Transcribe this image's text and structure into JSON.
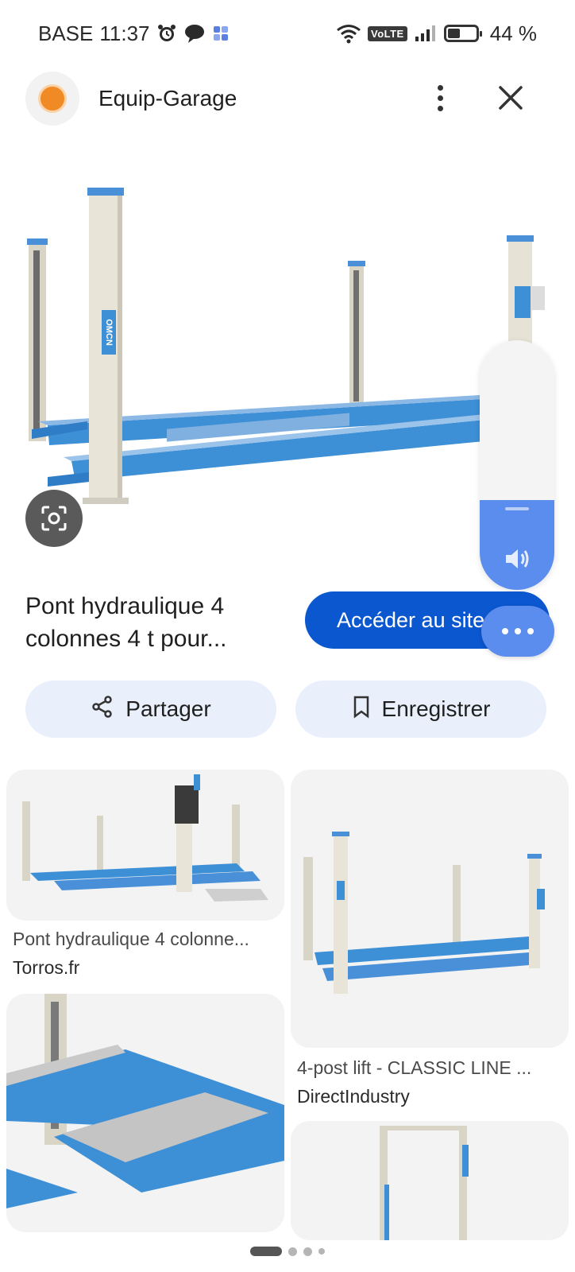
{
  "status_bar": {
    "carrier": "BASE",
    "time": "11:37",
    "network_badge": "VoLTE",
    "battery": "44 %",
    "battery_level": 0.44,
    "icons": [
      "alarm-icon",
      "chat-bubble-icon",
      "app-grid-icon",
      "wifi-icon",
      "signal-icon",
      "battery-icon"
    ]
  },
  "header": {
    "site_name": "Equip-Garage",
    "more_icon": "more-vert-icon",
    "close_icon": "close-icon"
  },
  "result": {
    "title": "Pont hydraulique 4 colonnes 4 t pour...",
    "visit_button": "Accéder au site",
    "share_button": "Partager",
    "save_button": "Enregistrer",
    "lens_icon": "lens-icon"
  },
  "volume_overlay": {
    "level": 0.36,
    "icon": "speaker-icon",
    "more_icon": "more-horiz-icon"
  },
  "related": [
    {
      "title": "Pont hydraulique 4 colonne...",
      "source": "Torros.fr"
    },
    {
      "title": "4-post lift - CLASSIC LINE ...",
      "source": "DirectIndustry"
    }
  ],
  "colors": {
    "accent": "#0b57d0",
    "chip_bg": "#e9f0fb",
    "lift_blue": "#3d8fd6",
    "column_beige": "#e8e4d8",
    "volume_blue": "#5b8def"
  },
  "pager": {
    "pages": 4,
    "active": 1
  }
}
